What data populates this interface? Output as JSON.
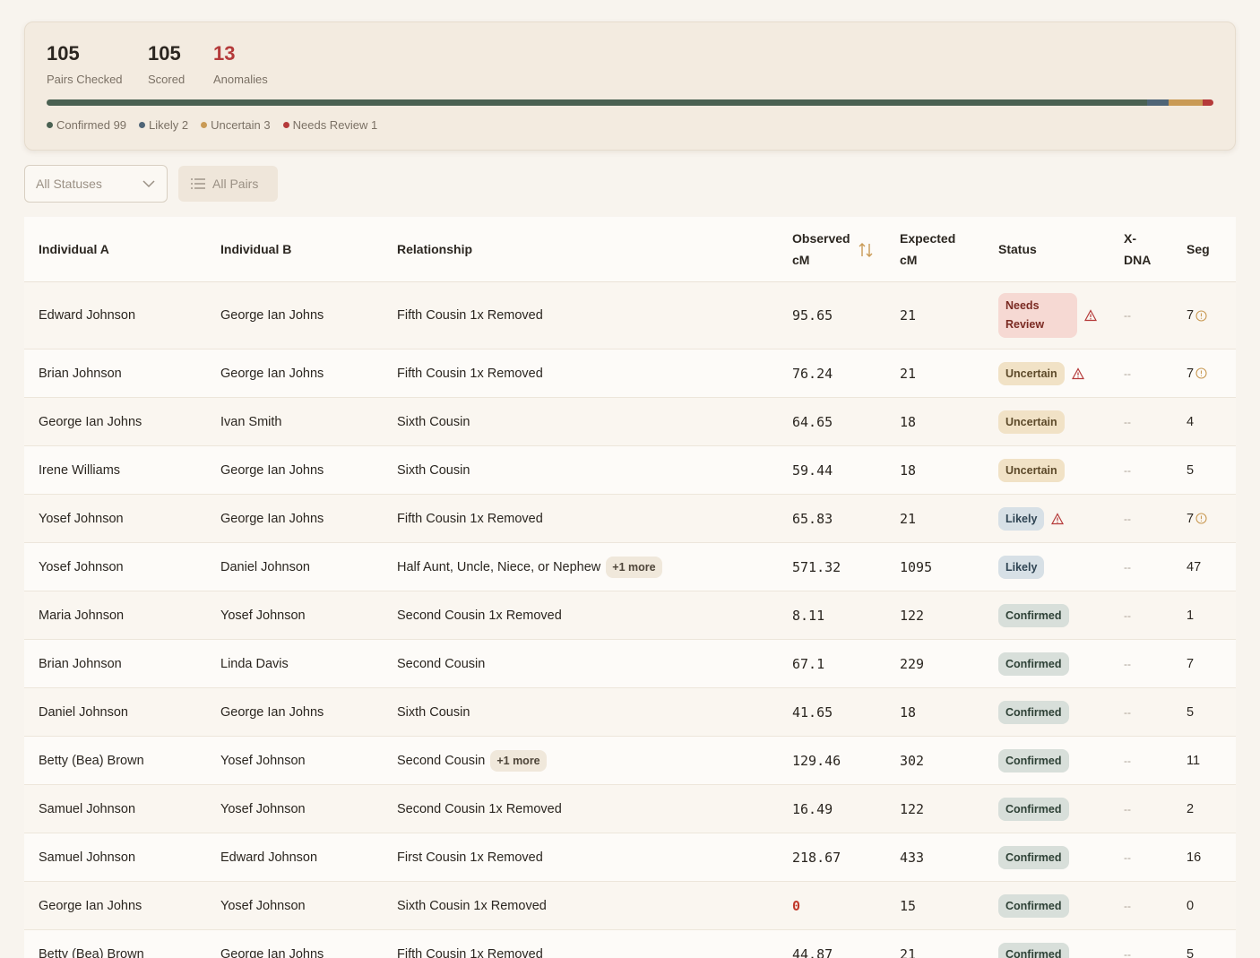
{
  "summary": {
    "pairs_checked": "105",
    "pairs_checked_label": "Pairs Checked",
    "scored": "105",
    "scored_label": "Scored",
    "anomalies": "13",
    "anomalies_label": "Anomalies",
    "progress": [
      {
        "status": "Confirmed",
        "count": 99,
        "color": "#4a6152"
      },
      {
        "status": "Likely",
        "count": 2,
        "color": "#4f6577"
      },
      {
        "status": "Uncertain",
        "count": 3,
        "color": "#c99a55"
      },
      {
        "status": "Needs Review",
        "count": 1,
        "color": "#b53a3a"
      }
    ],
    "legend": [
      {
        "label": "Confirmed 99",
        "color": "#4a6152"
      },
      {
        "label": "Likely 2",
        "color": "#4f6577"
      },
      {
        "label": "Uncertain 3",
        "color": "#c99a55"
      },
      {
        "label": "Needs Review 1",
        "color": "#b53a3a"
      }
    ]
  },
  "filters": {
    "status_select": "All Statuses",
    "pairs_button": "All Pairs"
  },
  "table": {
    "headers": {
      "a": "Individual A",
      "b": "Individual B",
      "rel": "Relationship",
      "obs_1": "Observed",
      "obs_2": "cM",
      "exp_1": "Expected",
      "exp_2": "cM",
      "status": "Status",
      "x_1": "X-",
      "x_2": "DNA",
      "seg": "Seg"
    },
    "rows": [
      {
        "a": "Edward Johnson",
        "b": "George Ian Johns",
        "rel": "Fifth Cousin 1x Removed",
        "more": "",
        "obs": "95.65",
        "exp": "21",
        "status": "Needs Review",
        "kind": "review",
        "warn": true,
        "x": "--",
        "seg": "7",
        "info": true
      },
      {
        "a": "Brian Johnson",
        "b": "George Ian Johns",
        "rel": "Fifth Cousin 1x Removed",
        "more": "",
        "obs": "76.24",
        "exp": "21",
        "status": "Uncertain",
        "kind": "uncertain",
        "warn": true,
        "x": "--",
        "seg": "7",
        "info": true
      },
      {
        "a": "George Ian Johns",
        "b": "Ivan Smith",
        "rel": "Sixth Cousin",
        "more": "",
        "obs": "64.65",
        "exp": "18",
        "status": "Uncertain",
        "kind": "uncertain",
        "warn": false,
        "x": "--",
        "seg": "4",
        "info": false
      },
      {
        "a": "Irene Williams",
        "b": "George Ian Johns",
        "rel": "Sixth Cousin",
        "more": "",
        "obs": "59.44",
        "exp": "18",
        "status": "Uncertain",
        "kind": "uncertain",
        "warn": false,
        "x": "--",
        "seg": "5",
        "info": false
      },
      {
        "a": "Yosef Johnson",
        "b": "George Ian Johns",
        "rel": "Fifth Cousin 1x Removed",
        "more": "",
        "obs": "65.83",
        "exp": "21",
        "status": "Likely",
        "kind": "likely",
        "warn": true,
        "x": "--",
        "seg": "7",
        "info": true
      },
      {
        "a": "Yosef Johnson",
        "b": "Daniel Johnson",
        "rel": "Half Aunt, Uncle, Niece, or Nephew",
        "more": "+1 more",
        "obs": "571.32",
        "exp": "1095",
        "status": "Likely",
        "kind": "likely",
        "warn": false,
        "x": "--",
        "seg": "47",
        "info": false
      },
      {
        "a": "Maria Johnson",
        "b": "Yosef Johnson",
        "rel": "Second Cousin 1x Removed",
        "more": "",
        "obs": "8.11",
        "exp": "122",
        "status": "Confirmed",
        "kind": "confirmed",
        "warn": false,
        "x": "--",
        "seg": "1",
        "info": false
      },
      {
        "a": "Brian Johnson",
        "b": "Linda Davis",
        "rel": "Second Cousin",
        "more": "",
        "obs": "67.1",
        "exp": "229",
        "status": "Confirmed",
        "kind": "confirmed",
        "warn": false,
        "x": "--",
        "seg": "7",
        "info": false
      },
      {
        "a": "Daniel Johnson",
        "b": "George Ian Johns",
        "rel": "Sixth Cousin",
        "more": "",
        "obs": "41.65",
        "exp": "18",
        "status": "Confirmed",
        "kind": "confirmed",
        "warn": false,
        "x": "--",
        "seg": "5",
        "info": false
      },
      {
        "a": "Betty (Bea) Brown",
        "b": "Yosef Johnson",
        "rel": "Second Cousin",
        "more": "+1 more",
        "obs": "129.46",
        "exp": "302",
        "status": "Confirmed",
        "kind": "confirmed",
        "warn": false,
        "x": "--",
        "seg": "11",
        "info": false
      },
      {
        "a": "Samuel Johnson",
        "b": "Yosef Johnson",
        "rel": "Second Cousin 1x Removed",
        "more": "",
        "obs": "16.49",
        "exp": "122",
        "status": "Confirmed",
        "kind": "confirmed",
        "warn": false,
        "x": "--",
        "seg": "2",
        "info": false
      },
      {
        "a": "Samuel Johnson",
        "b": "Edward Johnson",
        "rel": "First Cousin 1x Removed",
        "more": "",
        "obs": "218.67",
        "exp": "433",
        "status": "Confirmed",
        "kind": "confirmed",
        "warn": false,
        "x": "--",
        "seg": "16",
        "info": false
      },
      {
        "a": "George Ian Johns",
        "b": "Yosef Johnson",
        "rel": "Sixth Cousin 1x Removed",
        "more": "",
        "obs": "0",
        "exp": "15",
        "status": "Confirmed",
        "kind": "confirmed",
        "warn": false,
        "x": "--",
        "seg": "0",
        "info": false
      },
      {
        "a": "Betty (Bea) Brown",
        "b": "George Ian Johns",
        "rel": "Fifth Cousin 1x Removed",
        "more": "",
        "obs": "44.87",
        "exp": "21",
        "status": "Confirmed",
        "kind": "confirmed",
        "warn": false,
        "x": "--",
        "seg": "5",
        "info": false
      }
    ]
  }
}
